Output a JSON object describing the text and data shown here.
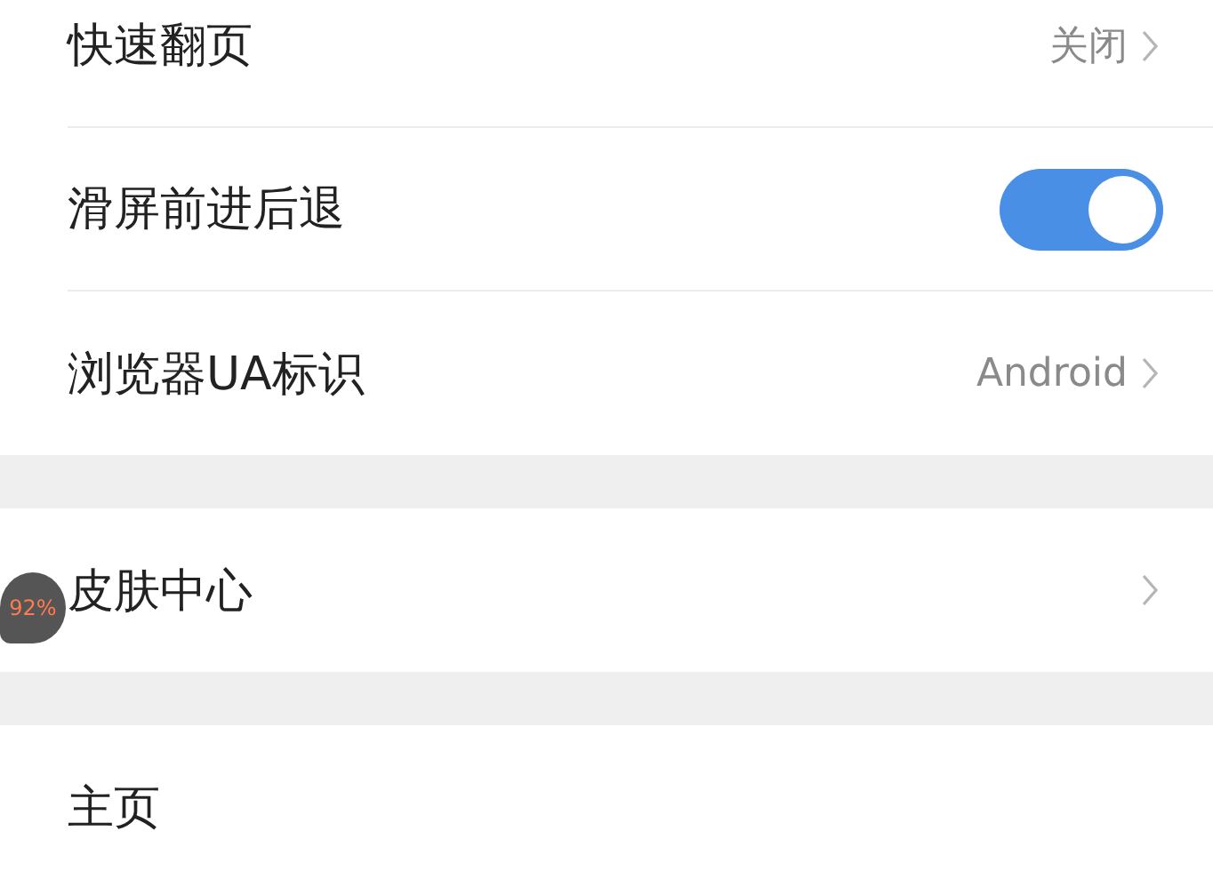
{
  "groups": [
    {
      "items": [
        {
          "label": "快速翻页",
          "kind": "value",
          "value": "关闭"
        },
        {
          "label": "滑屏前进后退",
          "kind": "toggle",
          "on": true
        },
        {
          "label": "浏览器UA标识",
          "kind": "value",
          "value": "Android"
        }
      ]
    },
    {
      "items": [
        {
          "label": "皮肤中心",
          "kind": "link"
        }
      ]
    },
    {
      "items": [
        {
          "label": "主页",
          "kind": "plain"
        }
      ]
    }
  ],
  "floating_ball": {
    "text": "92%"
  }
}
